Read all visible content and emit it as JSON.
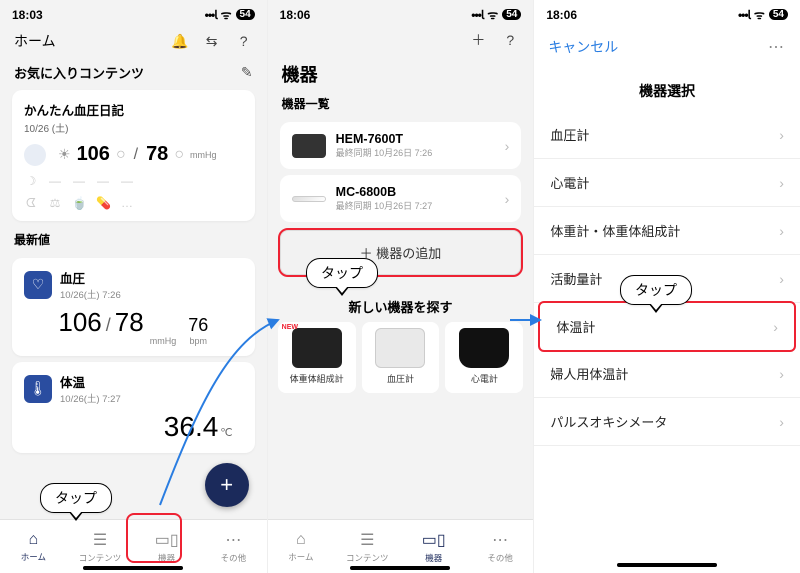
{
  "statusbar": {
    "time1": "18:03",
    "time2": "18:06",
    "time3": "18:06",
    "battery": "54"
  },
  "callout": "タップ",
  "screen1": {
    "home_label": "ホーム",
    "fav_title": "お気に入りコンテンツ",
    "diary_title": "かんたん血圧日記",
    "diary_date": "10/26 (土)",
    "sys": "106",
    "dia": "78",
    "bp_unit": "mmHg",
    "latest_title": "最新値",
    "bp_card_title": "血圧",
    "bp_card_date": "10/26(土) 7:26",
    "bp_sys": "106",
    "bp_dia": "78",
    "bp_mmHg": "mmHg",
    "pulse": "76",
    "bpm": "bpm",
    "temp_card_title": "体温",
    "temp_card_date": "10/26(土) 7:27",
    "temp_val": "36.4",
    "temp_unit": "℃",
    "tabs": {
      "home": "ホーム",
      "contents": "コンテンツ",
      "devices": "機器",
      "other": "その他"
    }
  },
  "screen2": {
    "title": "機器",
    "list_title": "機器一覧",
    "dev1_name": "HEM-7600T",
    "dev1_sub": "最終同期 10月26日 7:26",
    "dev2_name": "MC-6800B",
    "dev2_sub": "最終同期 10月26日 7:27",
    "add_label": "機器の追加",
    "explore_title": "新しい機器を探す",
    "new_badge": "NEW",
    "ex1": "体重体組成計",
    "ex2": "血圧計",
    "ex3": "心電計",
    "tabs": {
      "home": "ホーム",
      "contents": "コンテンツ",
      "devices": "機器",
      "other": "その他"
    }
  },
  "screen3": {
    "cancel": "キャンセル",
    "title": "機器選択",
    "rows": [
      "血圧計",
      "心電計",
      "体重計・体重体組成計",
      "活動量計",
      "体温計",
      "婦人用体温計",
      "パルスオキシメータ"
    ]
  }
}
